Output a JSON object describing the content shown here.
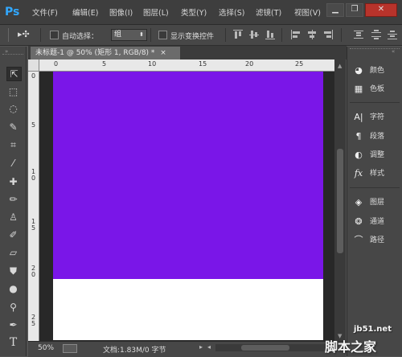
{
  "app": {
    "logo": "Ps"
  },
  "menu": [
    "文件(F)",
    "编辑(E)",
    "图像(I)",
    "图层(L)",
    "类型(Y)",
    "选择(S)",
    "滤镜(T)",
    "视图(V)"
  ],
  "window_buttons": {
    "minimize": "▁",
    "restore": "❐",
    "close": "✕"
  },
  "options": {
    "auto_select_label": "自动选择：",
    "group_value": "组",
    "show_transform_label": "显示变换控件"
  },
  "document": {
    "tab_title": "未标题-1 @ 50% (矩形 1, RGB/8) *",
    "tab_close": "×",
    "ruler_top": [
      "0",
      "5",
      "10",
      "15",
      "20",
      "25"
    ],
    "ruler_left": [
      "0",
      "5",
      "1\n0",
      "1\n5",
      "2\n0",
      "2\n5"
    ],
    "fill_color": "#7a16e8"
  },
  "status": {
    "zoom": "50%",
    "doc_info": "文档:1.83M/0 字节"
  },
  "panels": [
    {
      "icon": "palette-icon",
      "glyph": "◕",
      "label": "颜色"
    },
    {
      "icon": "swatches-icon",
      "glyph": "▦",
      "label": "色板"
    },
    {
      "icon": "character-icon",
      "glyph": "A|",
      "label": "字符"
    },
    {
      "icon": "paragraph-icon",
      "glyph": "¶",
      "label": "段落"
    },
    {
      "icon": "adjustments-icon",
      "glyph": "◐",
      "label": "调整"
    },
    {
      "icon": "styles-icon",
      "glyph": "fx",
      "label": "样式"
    },
    {
      "icon": "layers-icon",
      "glyph": "◈",
      "label": "图层"
    },
    {
      "icon": "channels-icon",
      "glyph": "❂",
      "label": "通道"
    },
    {
      "icon": "paths-icon",
      "glyph": "⌒",
      "label": "路径"
    }
  ],
  "watermark": {
    "site": "jb51.net",
    "name": "脚本之家"
  }
}
